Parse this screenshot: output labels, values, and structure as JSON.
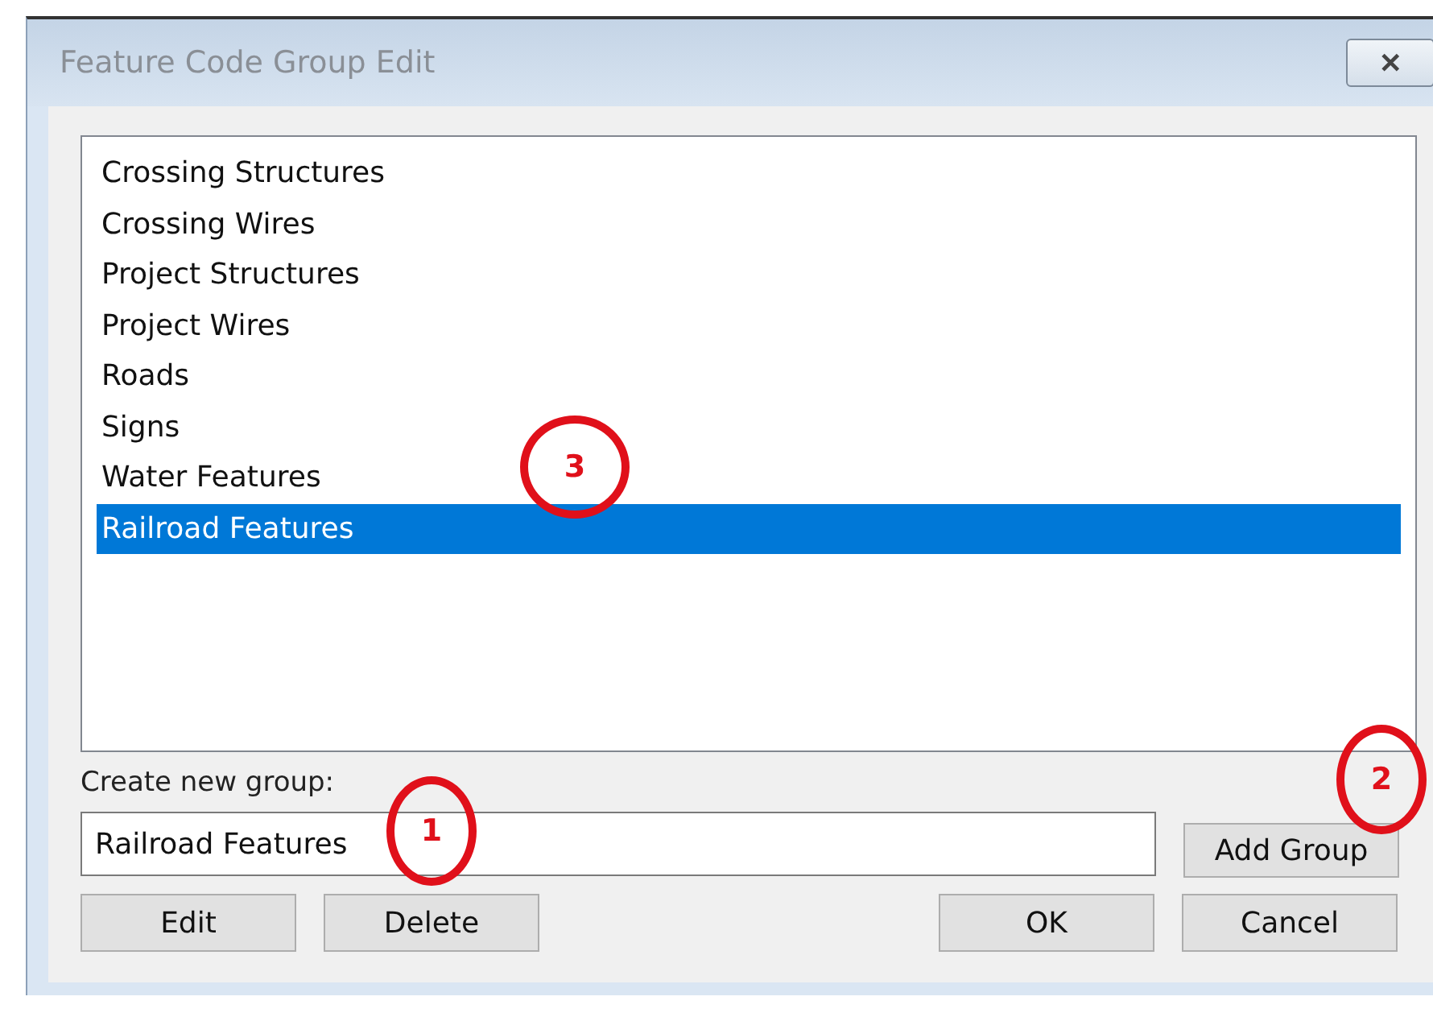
{
  "window": {
    "title": "Feature Code Group Edit",
    "close": "✕"
  },
  "group_list": [
    {
      "label": "Crossing Structures",
      "selected": false
    },
    {
      "label": "Crossing Wires",
      "selected": false
    },
    {
      "label": "Project Structures",
      "selected": false
    },
    {
      "label": "Project Wires",
      "selected": false
    },
    {
      "label": "Roads",
      "selected": false
    },
    {
      "label": "Signs",
      "selected": false
    },
    {
      "label": "Water Features",
      "selected": false
    },
    {
      "label": "Railroad Features",
      "selected": true
    }
  ],
  "new_group": {
    "label": "Create new group:",
    "value": "Railroad Features"
  },
  "buttons": {
    "add_group": "Add Group",
    "edit": "Edit",
    "delete": "Delete",
    "ok": "OK",
    "cancel": "Cancel"
  },
  "annotations": [
    {
      "label": "3"
    },
    {
      "label": "1"
    },
    {
      "label": "2"
    }
  ]
}
